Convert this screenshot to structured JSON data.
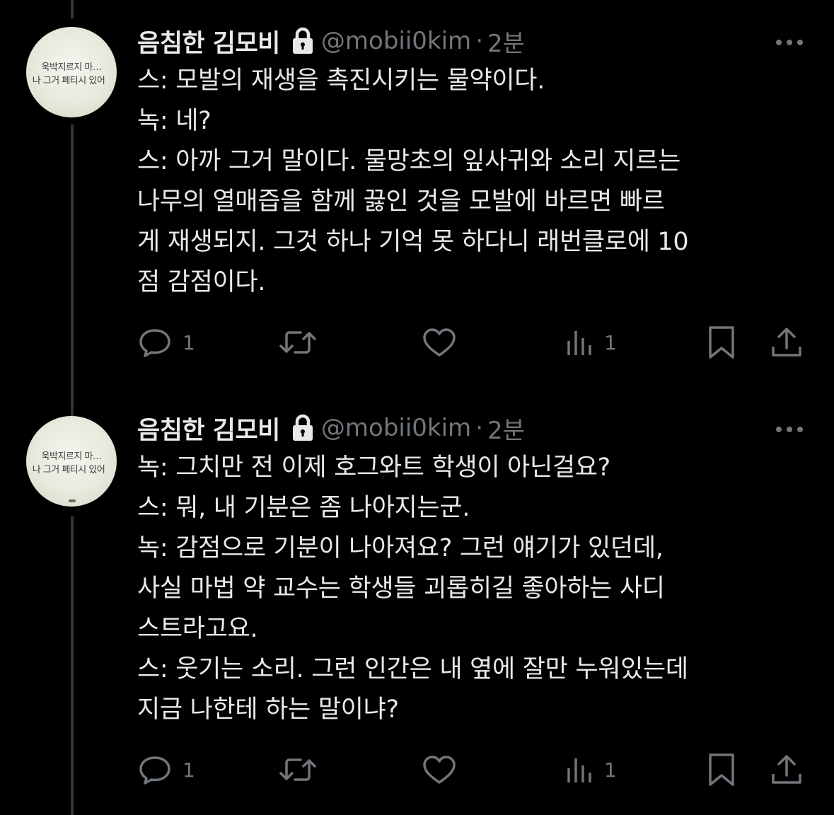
{
  "theme": {
    "background": "#000000",
    "text": "#e7e9ea",
    "muted": "#71767b",
    "thread_line": "#333639"
  },
  "tweets": [
    {
      "avatar": {
        "line1": "욱박지르지 마…",
        "line2": "나 그거 페티시 있어"
      },
      "display_name": "음침한 김모비",
      "protected_icon": "lock-icon",
      "handle": "@mobii0kim",
      "separator": "·",
      "time": "2분",
      "more_icon": "more-horizontal-icon",
      "lines": [
        "스: 모발의 재생을 촉진시키는 물약이다.",
        "녹: 네?",
        "스: 아까 그거 말이다. 물망초의 잎사귀와 소리 지르는",
        "나무의 열매즙을 함께 끓인 것을 모발에 바르면 빠르",
        "게 재생되지. 그것 하나 기억 못 하다니 래번클로에 10",
        "점 감점이다."
      ],
      "actions": {
        "reply": {
          "icon": "reply-icon",
          "count": "1"
        },
        "retweet": {
          "icon": "retweet-icon",
          "count": ""
        },
        "like": {
          "icon": "heart-icon",
          "count": ""
        },
        "views": {
          "icon": "views-icon",
          "count": "1"
        },
        "bookmark": {
          "icon": "bookmark-icon"
        },
        "share": {
          "icon": "share-icon"
        }
      }
    },
    {
      "avatar": {
        "line1": "욱박지르지 마…",
        "line2": "나 그거 페티시 있어"
      },
      "display_name": "음침한 김모비",
      "protected_icon": "lock-icon",
      "handle": "@mobii0kim",
      "separator": "·",
      "time": "2분",
      "more_icon": "more-horizontal-icon",
      "lines": [
        "녹: 그치만 전 이제 호그와트 학생이 아닌걸요?",
        "스: 뭐, 내 기분은 좀 나아지는군.",
        "녹: 감점으로 기분이 나아져요? 그런 얘기가 있던데,",
        "사실 마법 약 교수는 학생들 괴롭히길 좋아하는 사디",
        "스트라고요.",
        "스: 웃기는 소리. 그런 인간은 내 옆에 잘만 누워있는데",
        "지금 나한테 하는 말이냐?"
      ],
      "actions": {
        "reply": {
          "icon": "reply-icon",
          "count": "1"
        },
        "retweet": {
          "icon": "retweet-icon",
          "count": ""
        },
        "like": {
          "icon": "heart-icon",
          "count": ""
        },
        "views": {
          "icon": "views-icon",
          "count": "1"
        },
        "bookmark": {
          "icon": "bookmark-icon"
        },
        "share": {
          "icon": "share-icon"
        }
      }
    }
  ]
}
